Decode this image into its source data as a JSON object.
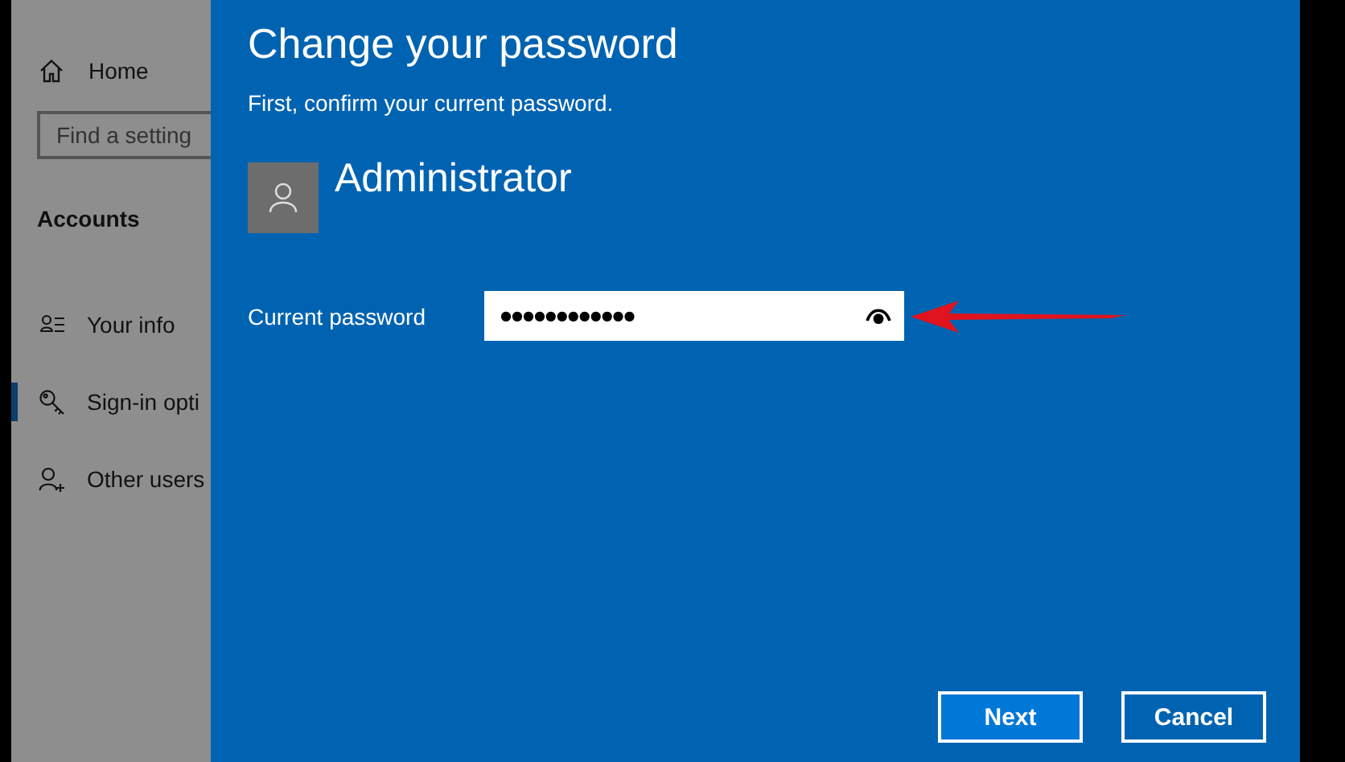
{
  "sidebar": {
    "home": "Home",
    "search": {
      "placeholder": "Find a setting"
    },
    "section": "Accounts",
    "items": [
      {
        "label": "Your info",
        "kind": "info",
        "selected": false
      },
      {
        "label": "Sign-in opti",
        "kind": "key",
        "selected": true
      },
      {
        "label": "Other users",
        "kind": "adduser",
        "selected": false
      }
    ]
  },
  "dialog": {
    "title": "Change your password",
    "subtitle": "First, confirm your current password.",
    "user": "Administrator",
    "field": {
      "label": "Current password",
      "value": "●●●●●●●●●●●●"
    },
    "buttons": [
      {
        "label": "Next",
        "kind": "primary"
      },
      {
        "label": "Cancel",
        "kind": "secondary"
      }
    ]
  }
}
